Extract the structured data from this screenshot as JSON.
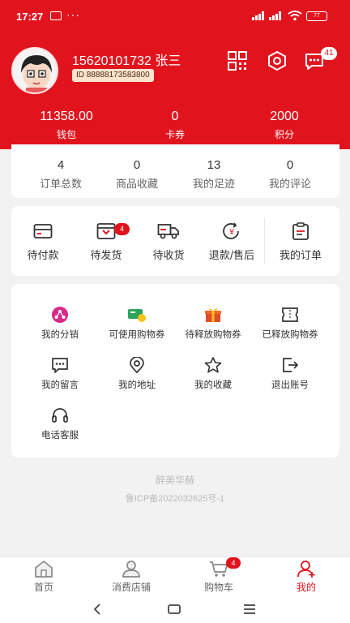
{
  "status_bar": {
    "time": "17:27",
    "dots": "···",
    "battery": "77"
  },
  "profile": {
    "name": "15620101732 张三",
    "id_prefix": "ID",
    "id_value": "88888173583800",
    "message_badge": "41",
    "icons": [
      "qrcode-icon",
      "settings-icon",
      "message-icon"
    ]
  },
  "stats": [
    {
      "value": "11358.00",
      "label": "钱包"
    },
    {
      "value": "0",
      "label": "卡券"
    },
    {
      "value": "2000",
      "label": "积分"
    }
  ],
  "counts": [
    {
      "value": "4",
      "label": "订单总数"
    },
    {
      "value": "0",
      "label": "商品收藏"
    },
    {
      "value": "13",
      "label": "我的足迹"
    },
    {
      "value": "0",
      "label": "我的评论"
    }
  ],
  "orders": {
    "items": [
      {
        "label": "待付款",
        "icon": "card-icon"
      },
      {
        "label": "待发货",
        "icon": "gift-box-icon"
      },
      {
        "label": "待收货",
        "icon": "truck-icon"
      },
      {
        "label": "退款/售后",
        "icon": "refund-icon"
      },
      {
        "label": "我的订单",
        "icon": "clipboard-icon"
      }
    ],
    "pending_ship_badge": "4"
  },
  "services": [
    {
      "label": "我的分销",
      "icon": "share-icon"
    },
    {
      "label": "可使用购物券",
      "icon": "coupon-icon"
    },
    {
      "label": "待释放购物券",
      "icon": "gift-icon"
    },
    {
      "label": "已释放购物券",
      "icon": "ticket-icon"
    },
    {
      "label": "我的留言",
      "icon": "comment-icon"
    },
    {
      "label": "我的地址",
      "icon": "location-icon"
    },
    {
      "label": "我的收藏",
      "icon": "star-icon"
    },
    {
      "label": "退出账号",
      "icon": "logout-icon"
    },
    {
      "label": "电话客服",
      "icon": "headset-icon"
    }
  ],
  "footer": {
    "brand": "醉美华赫",
    "icp": "鲁ICP备2022032625号-1"
  },
  "tabbar": {
    "items": [
      {
        "label": "首页",
        "icon": "home-icon"
      },
      {
        "label": "消费店铺",
        "icon": "shop-user-icon"
      },
      {
        "label": "购物车",
        "icon": "cart-icon"
      },
      {
        "label": "我的",
        "icon": "profile-icon"
      }
    ],
    "cart_badge": "4",
    "active": "我的"
  },
  "colors": {
    "brand_red": "#e1141e",
    "background": "#f2f2f2",
    "id_tag_bg": "#fde4cf"
  }
}
